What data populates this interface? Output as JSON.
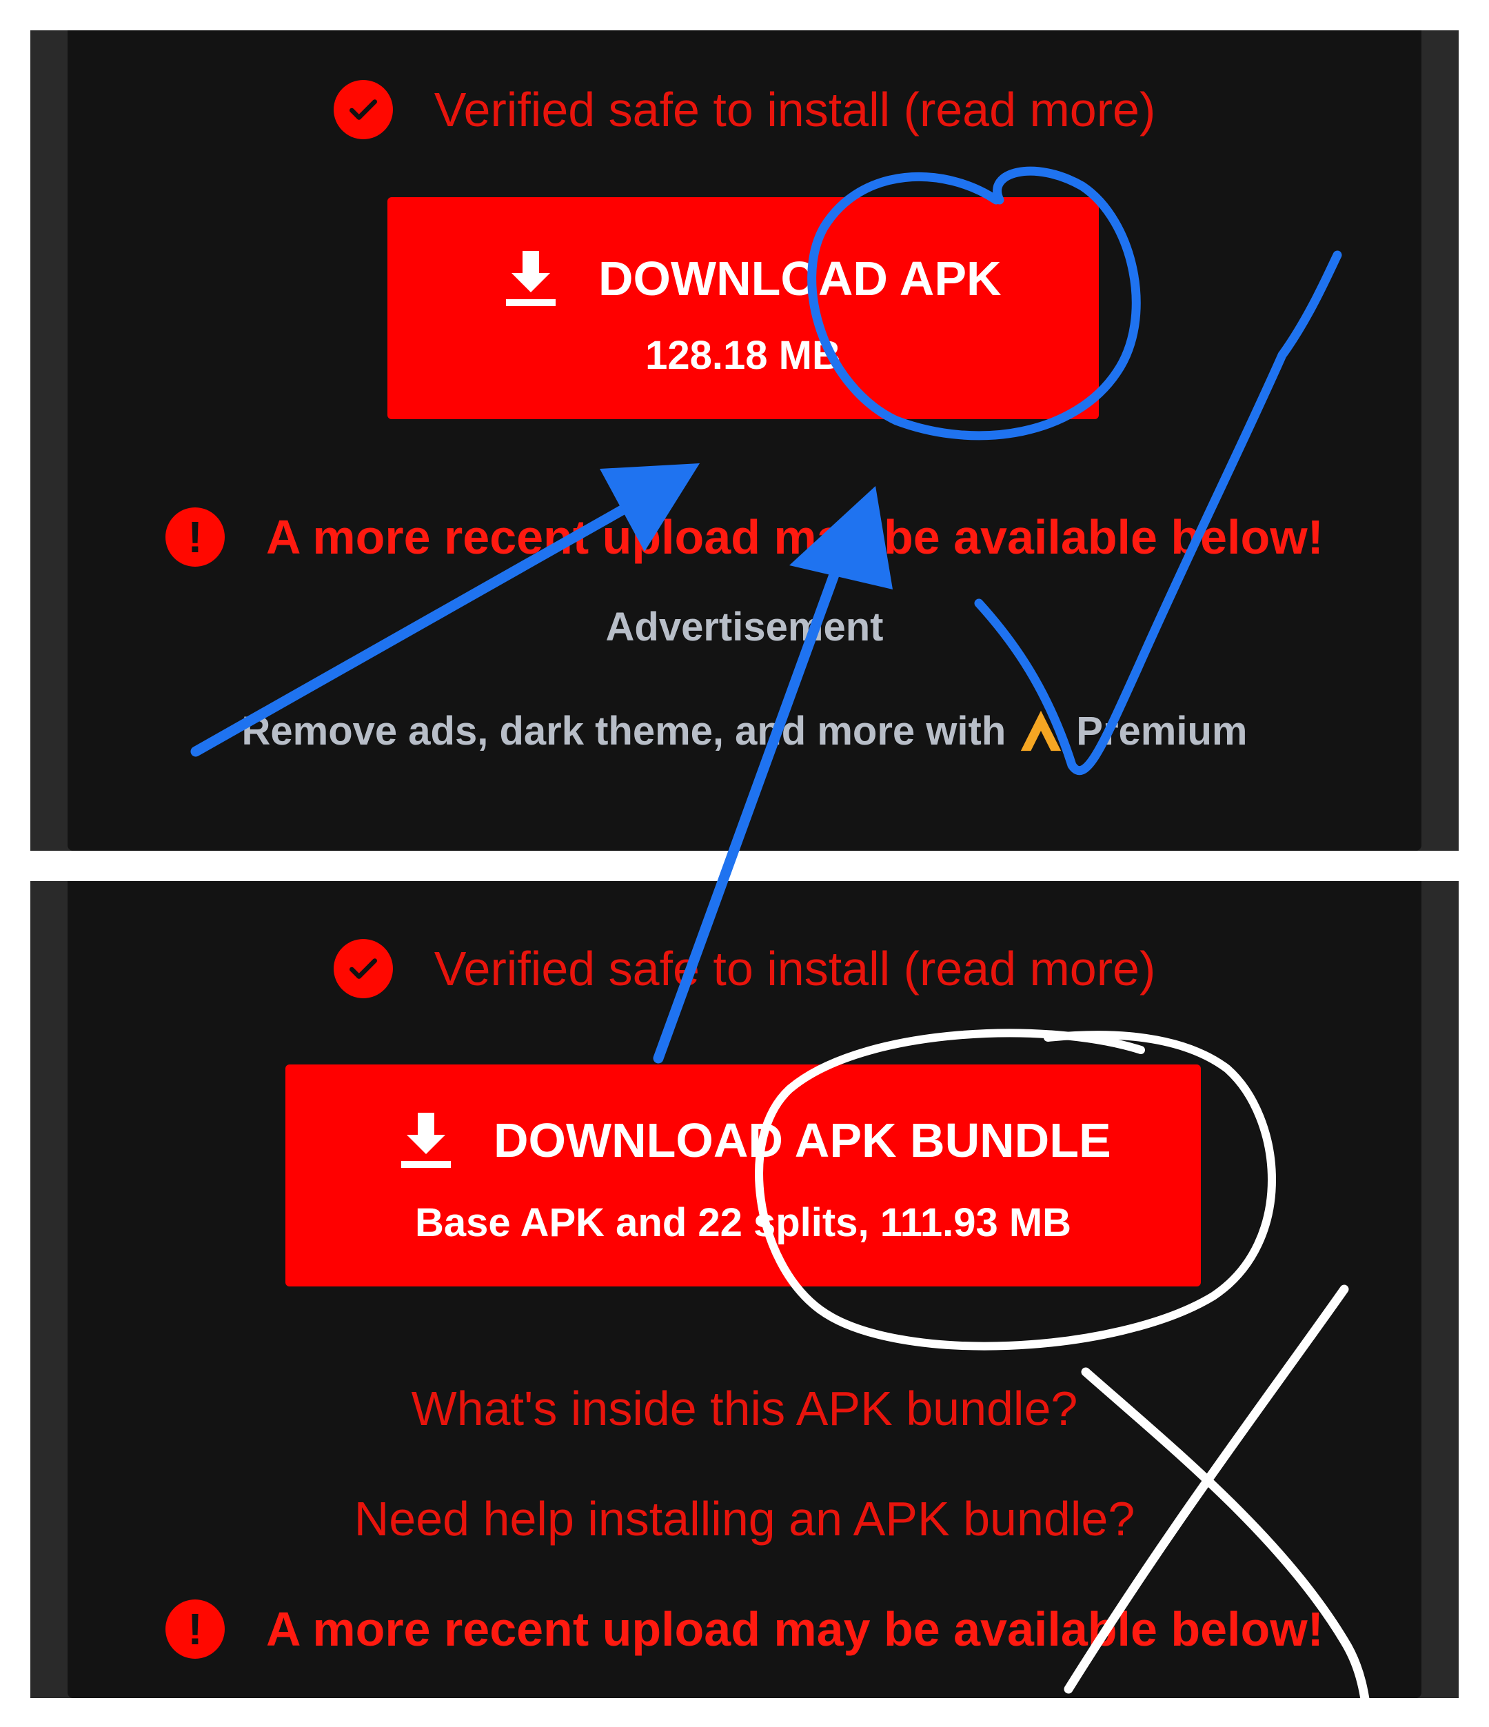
{
  "top": {
    "verified_text": "Verified safe to install (read more)",
    "download_title": "DOWNLOAD APK",
    "download_size": "128.18 MB",
    "warning_text": "A more recent upload may be available below!",
    "ad_label": "Advertisement",
    "premium_prefix": "Remove ads, dark theme, and more with",
    "premium_suffix": "Premium"
  },
  "bottom": {
    "verified_text": "Verified safe to install (read more)",
    "download_title": "DOWNLOAD APK BUNDLE",
    "download_sub": "Base APK and 22 splits, 111.93 MB",
    "link_inside": "What's inside this APK bundle?",
    "link_help": "Need help installing an APK bundle?",
    "warning_text": "A more recent upload may be available below!"
  },
  "colors": {
    "accent_red": "#ff0000",
    "text_red": "#e8140c",
    "panel_bg": "#131313",
    "annotation_blue": "#1f73f0",
    "annotation_white": "#ffffff",
    "premium_logo": "#f5a623"
  },
  "annotations": {
    "top_circle": "blue-circle",
    "checkmark": "blue-checkmark-icon",
    "arrows": "blue-arrows",
    "bottom_circle": "white-circle",
    "cross": "white-x-icon"
  }
}
